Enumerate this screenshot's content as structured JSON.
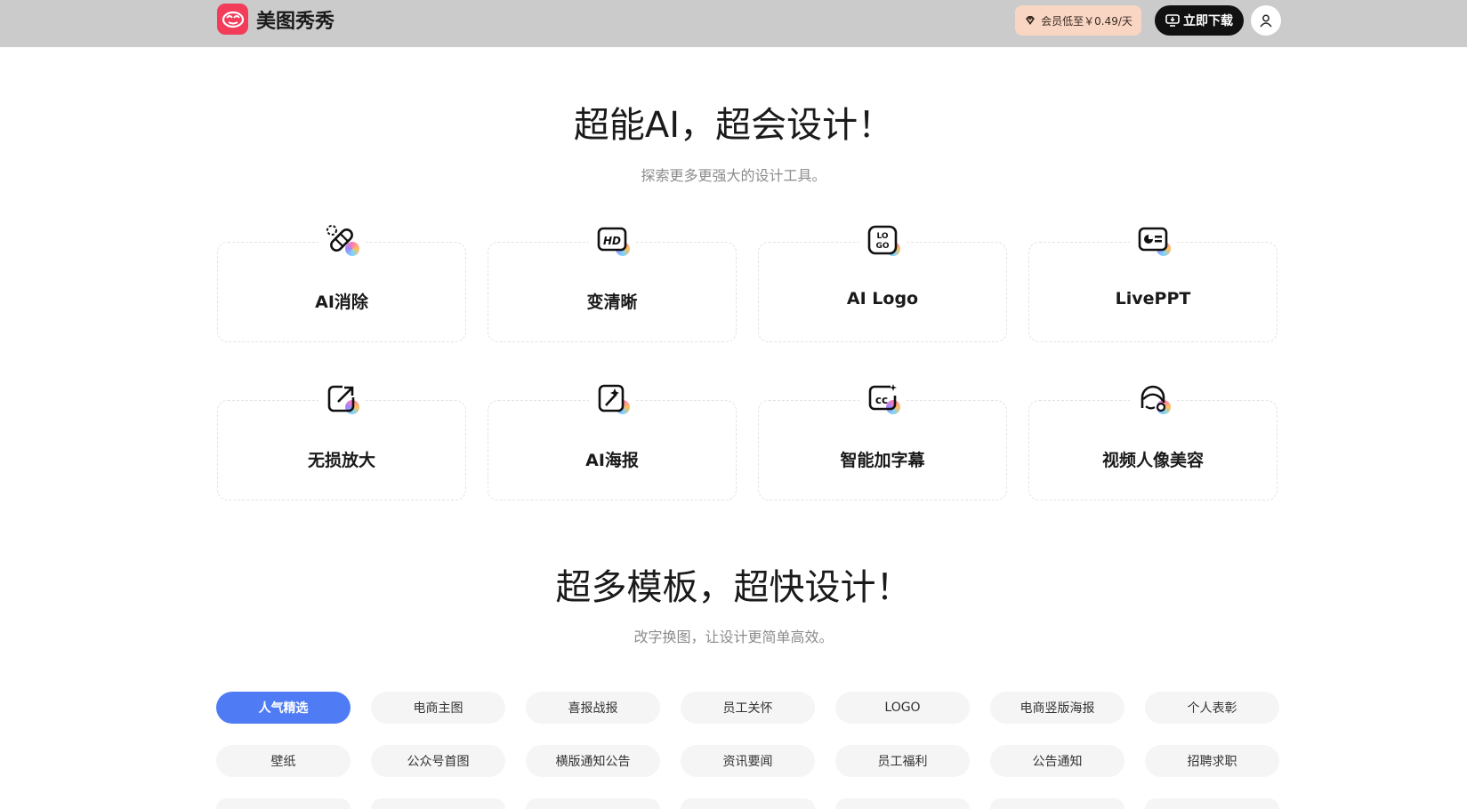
{
  "header": {
    "brand_name": "美图秀秀",
    "vip_label": "会员低至￥0.49/天",
    "download_label": "立即下载",
    "colors": {
      "bar": "#cbcbcb",
      "brand": "#f23c5a",
      "vip_bg": "#f9d6c4"
    }
  },
  "ai_section": {
    "title": "超能AI，超会设计！",
    "subtitle": "探索更多更强大的设计工具。",
    "tools": [
      {
        "label": "AI消除",
        "icon": "eraser-bandage-icon"
      },
      {
        "label": "变清晰",
        "icon": "hd-icon"
      },
      {
        "label": "AI Logo",
        "icon": "logo-icon"
      },
      {
        "label": "LivePPT",
        "icon": "ppt-icon"
      },
      {
        "label": "无损放大",
        "icon": "enlarge-icon"
      },
      {
        "label": "AI海报",
        "icon": "poster-icon"
      },
      {
        "label": "智能加字幕",
        "icon": "caption-icon"
      },
      {
        "label": "视频人像美容",
        "icon": "portrait-beauty-icon"
      }
    ]
  },
  "template_section": {
    "title": "超多模板，超快设计！",
    "subtitle": "改字换图，让设计更简单高效。",
    "active_color": "#4f7cf5",
    "chips_row1": [
      "人气精选",
      "电商主图",
      "喜报战报",
      "员工关怀",
      "LOGO",
      "电商竖版海报",
      "个人表彰"
    ],
    "chips_row2": [
      "壁纸",
      "公众号首图",
      "横版通知公告",
      "资讯要闻",
      "员工福利",
      "公告通知",
      "招聘求职"
    ]
  }
}
